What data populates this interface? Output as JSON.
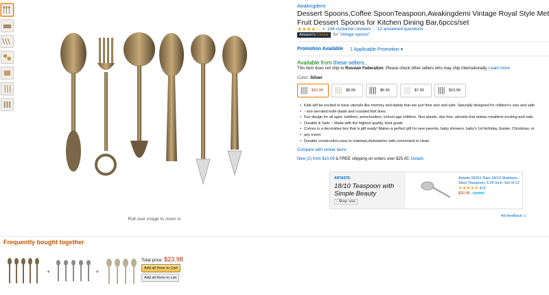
{
  "thumbnails": [
    "thumb-1",
    "thumb-2",
    "thumb-3",
    "thumb-4",
    "thumb-5",
    "thumb-6",
    "thumb-7"
  ],
  "main_image": {
    "hint": "Roll over image to zoom in"
  },
  "product": {
    "brand": "Awakingdemi",
    "title_line1": "Dessert Spoons,Coffee SpoonTeaspoon,Awakingdemi Vintage Royal Style Metal Carved",
    "title_line2": "Fruit Dessert Spoons for Kitchen Dining Bar,6pccs/set",
    "stars": "★★★★☆",
    "review_count": "144 customer reviews",
    "answered": "12 answered questions",
    "choice_badge_prefix": "Amazon's",
    "choice_badge_suffix": "Choice",
    "choice_for": "for",
    "choice_query": "\"vintage spoons\""
  },
  "promotion": {
    "label": "Promotion Available",
    "link": "1 Applicable Promotion ▾"
  },
  "availability": {
    "prefix": "Available from",
    "link": "these sellers.",
    "ship_text_1": "This item does not ship to",
    "ship_country": "Russian Federation",
    "ship_text_2": ". Please check other sellers who may ship internationally.",
    "learn_more": "Learn more"
  },
  "color": {
    "label": "Color:",
    "value": "Silver"
  },
  "swatches": [
    {
      "price": "$10.99"
    },
    {
      "price": "$8.99"
    },
    {
      "price": "$6.99"
    },
    {
      "price": "$7.99"
    },
    {
      "price": "$10.99"
    }
  ],
  "bullets": [
    "Kids will be excited to have utensils like mommy and daddy that are just their size and safe. Specially designed for children's size and safe",
    "- non-serrated knife blade and rounded fork tines.",
    "Fun design for all ages: toddlers, preschoolers, school age children. Non-plastic, dye free, utensils that makes mealtime exciting and safe.",
    "Durable & Safe -- Made with the highest quality, food grade",
    "Comes in a decorative box that is gift ready! Makes a perfect gift for new parents, baby showers, baby's 1st birthday, Easter, Christmas, or",
    "any event.",
    "Durable construction,easy to maintain,dishwasher safe,convenient to clean."
  ],
  "compare": "Compare with similar items",
  "new_offers": {
    "link": "New (2) from $10.09",
    "text": " & FREE shipping on orders over $25.00.",
    "details": "Details"
  },
  "ad": {
    "brand": "ARTASTE",
    "headline_1": "18/10 Teaspoon with",
    "headline_2": "Simple Beauty",
    "shop": "› Shop now",
    "title": "Artaste 59311 Rain 18/10 Stainless Steel Teaspoon, 6.25-Inch, Set of 12",
    "stars": "★★★★★",
    "count": "472",
    "price": "$20.95",
    "prime": "✓prime",
    "feedback": "Ad feedback ▭"
  },
  "fbt": {
    "title": "Frequently bought together",
    "total_label": "Total price:",
    "total_price": "$23.98",
    "add_cart": "Add all three to Cart",
    "add_list": "Add all three to List",
    "plus": "+"
  }
}
